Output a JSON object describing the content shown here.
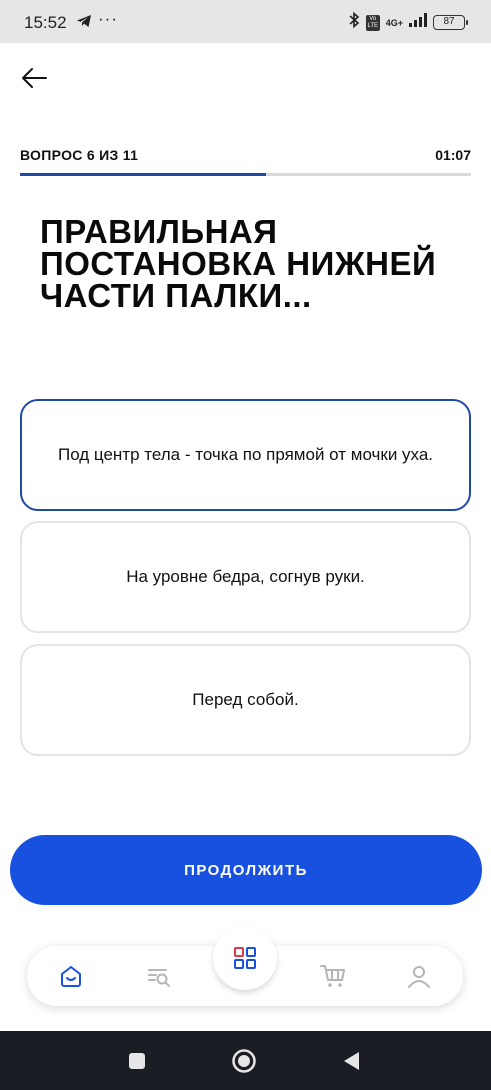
{
  "status_bar": {
    "time": "15:52",
    "dots": "···",
    "network": "4G+",
    "volte": "Vo LTE",
    "battery": "87"
  },
  "quiz": {
    "counter": "ВОПРОС 6 ИЗ 11",
    "timer": "01:07",
    "progress": 0.545,
    "question": "ПРАВИЛЬНАЯ ПОСТАНОВКА НИЖНЕЙ ЧАСТИ ПАЛКИ...",
    "answers": [
      {
        "text": "Под центр тела - точка по прямой от мочки уха.",
        "selected": true
      },
      {
        "text": "На уровне бедра, согнув руки.",
        "selected": false
      },
      {
        "text": "Перед собой.",
        "selected": false
      }
    ],
    "continue_label": "ПРОДОЛЖИТЬ"
  },
  "bottom_nav": {
    "items": [
      "home-icon",
      "search-list-icon",
      "catalog-grid-icon",
      "cart-icon",
      "profile-icon"
    ],
    "active": "home-icon"
  },
  "colors": {
    "accent": "#1851e0",
    "selected_border": "#1e4aa8",
    "progress": "#1e4aa8"
  }
}
